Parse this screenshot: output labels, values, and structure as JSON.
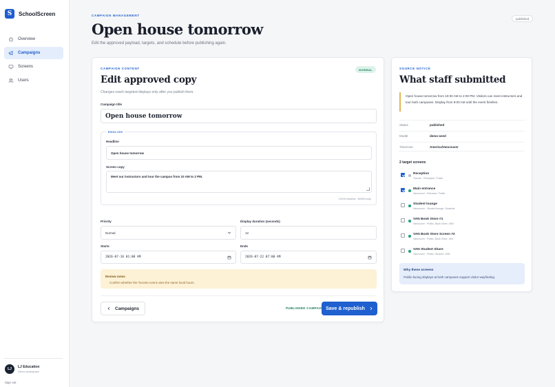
{
  "brand": {
    "logo_letter": "S",
    "name": "SchoolScreen"
  },
  "sidebar": {
    "items": [
      {
        "label": "Overview",
        "icon": "home-icon",
        "active": false
      },
      {
        "label": "Campaigns",
        "icon": "megaphone-icon",
        "active": true
      },
      {
        "label": "Screens",
        "icon": "monitor-icon",
        "active": false
      },
      {
        "label": "Users",
        "icon": "users-icon",
        "active": false
      }
    ],
    "org": {
      "initials": "LJ",
      "name": "LJ Education",
      "sub": "Demo workspace"
    },
    "signout": "Sign out"
  },
  "header": {
    "eyebrow": "CAMPAIGN MANAGEMENT",
    "title": "Open house tomorrow",
    "subtitle": "Edit the approved payload, targets, and schedule before publishing again.",
    "status_pill": "published"
  },
  "main": {
    "eyebrow": "CAMPAIGN CONTENT",
    "title": "Edit approved copy",
    "subtitle": "Changes reach targeted displays only after you publish them.",
    "priority_badge": "NORMAL",
    "campaign_title_label": "Campaign title",
    "campaign_title_value": "Open house tomorrow",
    "language_legend": "ENGLISH",
    "headline_label": "Headline",
    "headline_value": "Open house tomorrow",
    "copy_label": "Screen copy",
    "copy_value": "Meet our instructors and tour the campus from 10 AM to 2 PM.",
    "counts": "19/100 headline · 60/500 body",
    "priority_label": "Priority",
    "priority_value": "Normal",
    "duration_label": "Display duration (seconds)",
    "duration_value": "12",
    "starts_label": "Starts",
    "starts_value": "2026-07-16 01:00 AM",
    "ends_label": "Ends",
    "ends_value": "2026-07-22 07:00 AM",
    "review_title": "Review notes",
    "review_text": "Confirm whether the Toronto event uses the same local hours.",
    "back_label": "Campaigns",
    "published_label": "PUBLISHED CAMPAIGN",
    "save_label": "Save & republish"
  },
  "source": {
    "eyebrow": "SOURCE NOTICE",
    "title": "What staff submitted",
    "notice": "Open house tomorrow from 10:00 AM to 2:00 PM. Visitors can meet instructors and tour both campuses. Display from 8:00 AM until the event finishes.",
    "meta": [
      {
        "key": "Status",
        "value": "published"
      },
      {
        "key": "Model",
        "value": "demo-seed"
      },
      {
        "key": "Timezone",
        "value": "America/Vancouver"
      }
    ],
    "targets_heading": "2 target screens",
    "screens": [
      {
        "name": "Reception",
        "tags": "Toronto · Reception, Public",
        "checked": true,
        "online": false
      },
      {
        "name": "Main entrance",
        "tags": "Vancouver · Entrance, Public",
        "checked": true,
        "online": true
      },
      {
        "name": "Student lounge",
        "tags": "Vancouver · Student lounge, Students",
        "checked": false,
        "online": true
      },
      {
        "name": "VAN Book Store #1",
        "tags": "Vancouver · Public, Book Store, VAN",
        "checked": false,
        "online": true
      },
      {
        "name": "VAN Book Store Screen #2",
        "tags": "Vancouver · Public, Book Store, Van",
        "checked": false,
        "online": true
      },
      {
        "name": "VAN Student Share",
        "tags": "Vancouver · Public, Student, VAN",
        "checked": false,
        "online": true
      }
    ],
    "why_title": "Why these screens",
    "why_text": "Public-facing displays at both campuses support visitor wayfinding."
  },
  "colors": {
    "accent": "#1f5fcf",
    "success": "#177a55",
    "warning_bg": "#fdf1d6",
    "info_bg": "#e6edfb"
  }
}
